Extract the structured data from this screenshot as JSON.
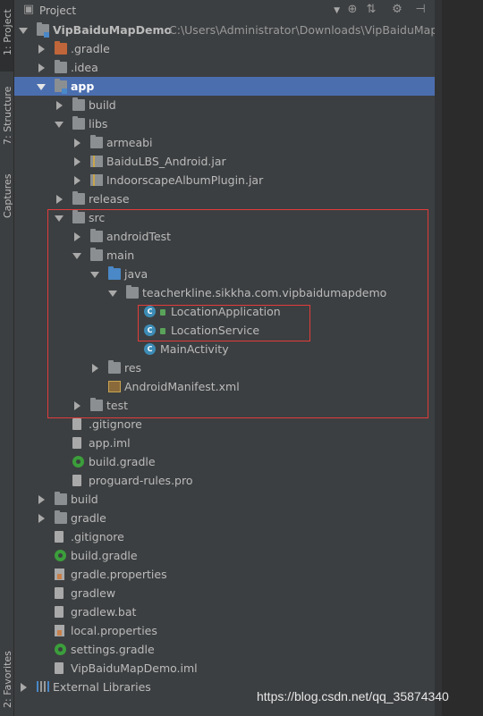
{
  "sidebar": {
    "tabs": [
      {
        "label": "1: Project"
      },
      {
        "label": "7: Structure"
      },
      {
        "label": "Captures"
      },
      {
        "label": "2: Favorites"
      }
    ]
  },
  "toolbar": {
    "title": "Project",
    "dropdown_icon": "caret-down-icon",
    "icons": [
      "target-icon",
      "collapse-icon",
      "gear-icon",
      "hide-icon"
    ]
  },
  "tree": [
    {
      "label": "VipBaiduMapDemo",
      "path": "C:\\Users\\Administrator\\Downloads\\VipBaiduMapDe",
      "icon": "module-folder",
      "expanded": true,
      "bold": true
    },
    {
      "label": ".gradle",
      "icon": "folder-orange",
      "expanded": false
    },
    {
      "label": ".idea",
      "icon": "folder",
      "expanded": false
    },
    {
      "label": "app",
      "icon": "module-folder",
      "expanded": true,
      "selected": true
    },
    {
      "label": "build",
      "icon": "folder",
      "expanded": false
    },
    {
      "label": "libs",
      "icon": "folder",
      "expanded": true
    },
    {
      "label": "armeabi",
      "icon": "folder",
      "expanded": false
    },
    {
      "label": "BaiduLBS_Android.jar",
      "icon": "jar",
      "expanded": false
    },
    {
      "label": "IndoorscapeAlbumPlugin.jar",
      "icon": "jar",
      "expanded": false
    },
    {
      "label": "release",
      "icon": "folder",
      "expanded": false
    },
    {
      "label": "src",
      "icon": "folder",
      "expanded": true
    },
    {
      "label": "androidTest",
      "icon": "folder",
      "expanded": false
    },
    {
      "label": "main",
      "icon": "folder",
      "expanded": true
    },
    {
      "label": "java",
      "icon": "folder-blue",
      "expanded": true
    },
    {
      "label": "teacherkline.sikkha.com.vipbaidumapdemo",
      "icon": "package",
      "expanded": true
    },
    {
      "label": "LocationApplication",
      "icon": "class",
      "locked": true
    },
    {
      "label": "LocationService",
      "icon": "class",
      "locked": true
    },
    {
      "label": "MainActivity",
      "icon": "class"
    },
    {
      "label": "res",
      "icon": "res-folder",
      "expanded": false
    },
    {
      "label": "AndroidManifest.xml",
      "icon": "manifest"
    },
    {
      "label": "test",
      "icon": "folder",
      "expanded": false
    },
    {
      "label": ".gitignore",
      "icon": "file"
    },
    {
      "label": "app.iml",
      "icon": "file"
    },
    {
      "label": "build.gradle",
      "icon": "gradle"
    },
    {
      "label": "proguard-rules.pro",
      "icon": "file"
    },
    {
      "label": "build",
      "icon": "folder",
      "expanded": false
    },
    {
      "label": "gradle",
      "icon": "folder",
      "expanded": false
    },
    {
      "label": ".gitignore",
      "icon": "file"
    },
    {
      "label": "build.gradle",
      "icon": "gradle"
    },
    {
      "label": "gradle.properties",
      "icon": "properties"
    },
    {
      "label": "gradlew",
      "icon": "file"
    },
    {
      "label": "gradlew.bat",
      "icon": "file"
    },
    {
      "label": "local.properties",
      "icon": "properties"
    },
    {
      "label": "settings.gradle",
      "icon": "gradle"
    },
    {
      "label": "VipBaiduMapDemo.iml",
      "icon": "file"
    },
    {
      "label": "External Libraries",
      "icon": "libraries",
      "expanded": false
    }
  ],
  "watermark": "https://blog.csdn.net/qq_35874340",
  "colors": {
    "selection": "#4b6eaf",
    "highlight_box": "#e23b3b",
    "panel": "#3c3f41"
  }
}
